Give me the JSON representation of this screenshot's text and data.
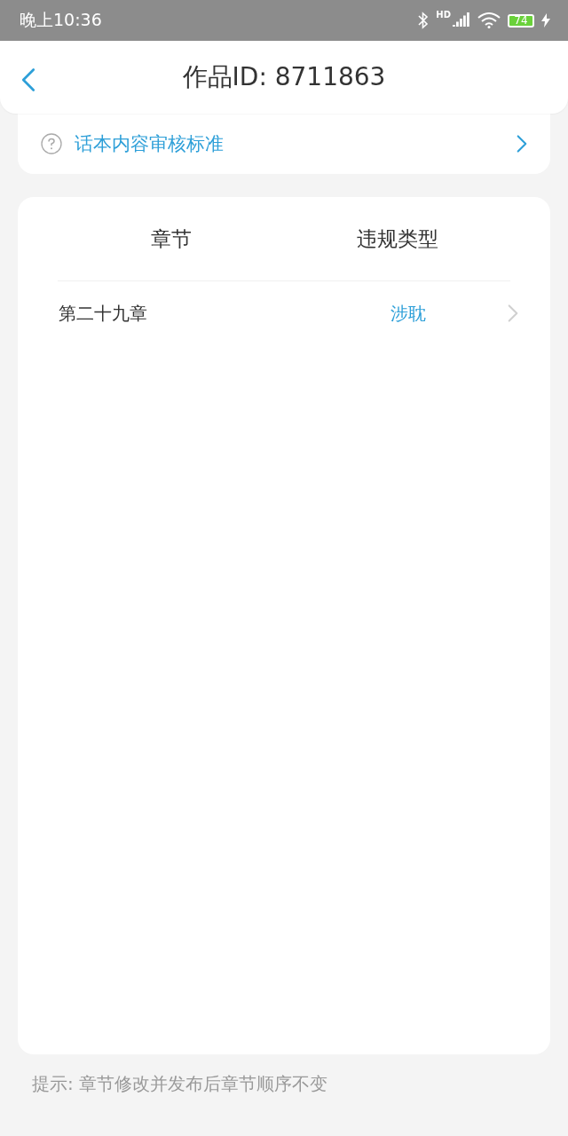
{
  "status_bar": {
    "time": "晚上10:36",
    "network": "HD",
    "battery": "74"
  },
  "header": {
    "title": "作品ID: 8711863"
  },
  "standard_link": {
    "label": "话本内容审核标准"
  },
  "table": {
    "columns": [
      "章节",
      "违规类型"
    ],
    "rows": [
      {
        "chapter": "第二十九章",
        "violation": "涉耽"
      }
    ]
  },
  "hint": "提示: 章节修改并发布后章节顺序不变"
}
